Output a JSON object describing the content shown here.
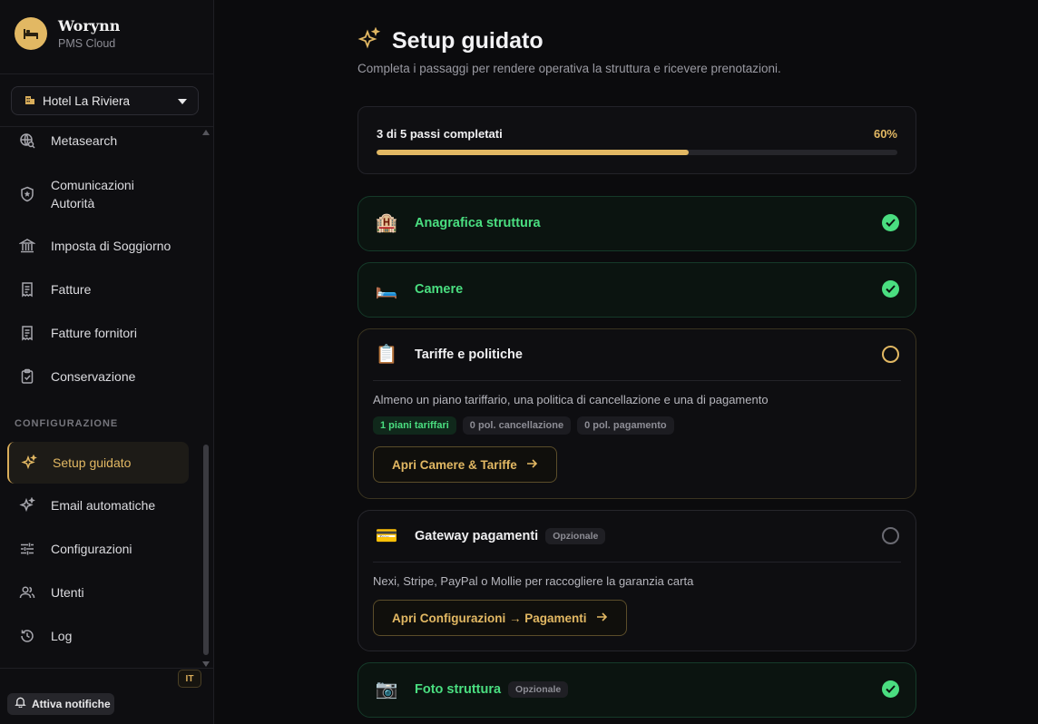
{
  "brand": {
    "name": "Worynn",
    "subtitle": "PMS Cloud"
  },
  "hotel_selector": {
    "value": "Hotel La Riviera"
  },
  "sidebar": {
    "items": [
      {
        "label": "Metasearch",
        "icon": "globe-search-icon"
      },
      {
        "label": "Comunicazioni Autorità",
        "icon": "shield-star-icon"
      },
      {
        "label": "Imposta di Soggiorno",
        "icon": "bank-icon"
      },
      {
        "label": "Fatture",
        "icon": "receipt-icon"
      },
      {
        "label": "Fatture fornitori",
        "icon": "receipt-icon"
      },
      {
        "label": "Conservazione",
        "icon": "clipboard-check-icon"
      }
    ],
    "section_label": "CONFIGURAZIONE",
    "config_items": [
      {
        "label": "Setup guidato",
        "icon": "sparkle-icon",
        "active": true
      },
      {
        "label": "Email automatiche",
        "icon": "sparkle-icon"
      },
      {
        "label": "Configurazioni",
        "icon": "sliders-icon"
      },
      {
        "label": "Utenti",
        "icon": "users-icon"
      },
      {
        "label": "Log",
        "icon": "history-icon"
      }
    ],
    "language": "IT",
    "notifications_label": "Attiva notifiche"
  },
  "page": {
    "title": "Setup guidato",
    "subtitle": "Completa i passaggi per rendere operativa la struttura e ricevere prenotazioni."
  },
  "progress": {
    "label": "3 di 5 passi completati",
    "percent_label": "60%",
    "value": 0.6
  },
  "steps": [
    {
      "title": "Anagrafica struttura",
      "emoji": "🏨",
      "status": "done"
    },
    {
      "title": "Camere",
      "emoji": "🛏️",
      "status": "done"
    },
    {
      "title": "Tariffe e politiche",
      "emoji": "📋",
      "status": "pending",
      "description": "Almeno un piano tariffario, una politica di cancellazione e una di pagamento",
      "chips": [
        "1 piani tariffari",
        "0 pol. cancellazione",
        "0 pol. pagamento"
      ],
      "action": "Apri Camere & Tariffe"
    },
    {
      "title": "Gateway pagamenti",
      "emoji": "💳",
      "status": "pending",
      "optional": "Opzionale",
      "description": "Nexi, Stripe, PayPal o Mollie per raccogliere la garanzia carta",
      "action": "Apri Configurazioni → Pagamenti"
    },
    {
      "title": "Foto struttura",
      "emoji": "📷",
      "status": "done",
      "optional": "Opzionale"
    }
  ],
  "colors": {
    "accent": "#e2b863",
    "success": "#4ade80",
    "background": "#0b0b0d"
  }
}
